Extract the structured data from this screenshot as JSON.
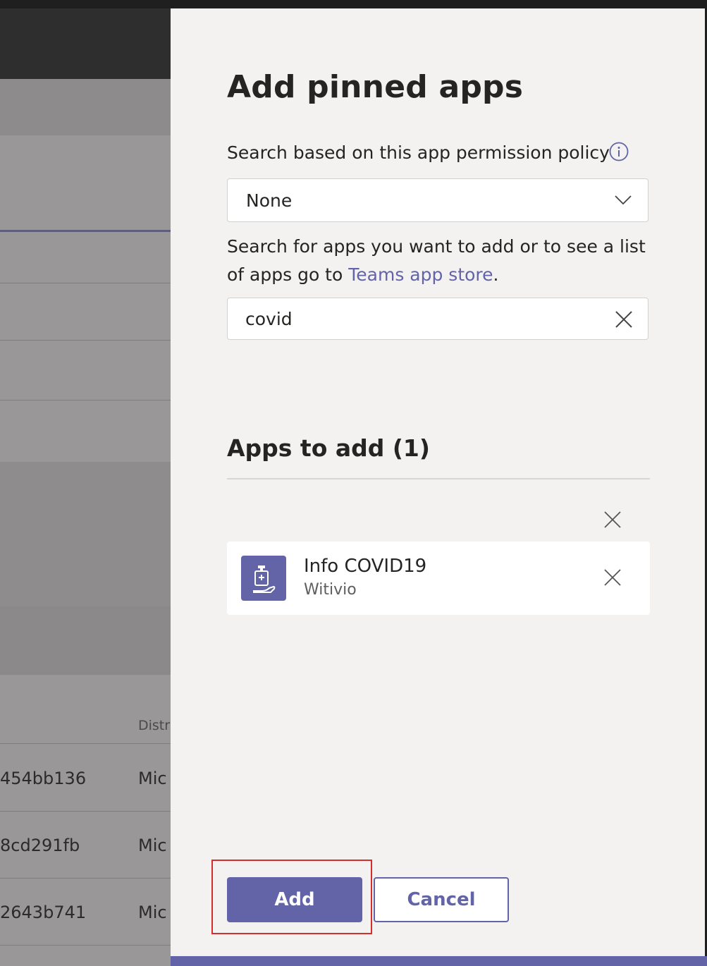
{
  "background": {
    "column_header": "Distr",
    "rows": [
      {
        "id": "454bb136",
        "distributor": "Mic"
      },
      {
        "id": "8cd291fb",
        "distributor": "Mic"
      },
      {
        "id": "2643b741",
        "distributor": "Mic"
      }
    ]
  },
  "panel": {
    "title": "Add pinned apps",
    "policy_label": "Search based on this app permission policy",
    "policy_value": "None",
    "help_text": "Search for apps you want to add or to see a list of apps go to",
    "help_link": "Teams app store",
    "help_suffix": ".",
    "search_value": "covid",
    "section_title": "Apps to add (1)",
    "apps": [
      {
        "name": "Info COVID19",
        "publisher": "Witivio"
      }
    ],
    "add_label": "Add",
    "cancel_label": "Cancel"
  },
  "colors": {
    "accent": "#6264a7",
    "highlight": "#d62c2c"
  },
  "icons": [
    "info-icon",
    "chevron-down-icon",
    "close-icon",
    "hand-sanitizer-icon"
  ]
}
